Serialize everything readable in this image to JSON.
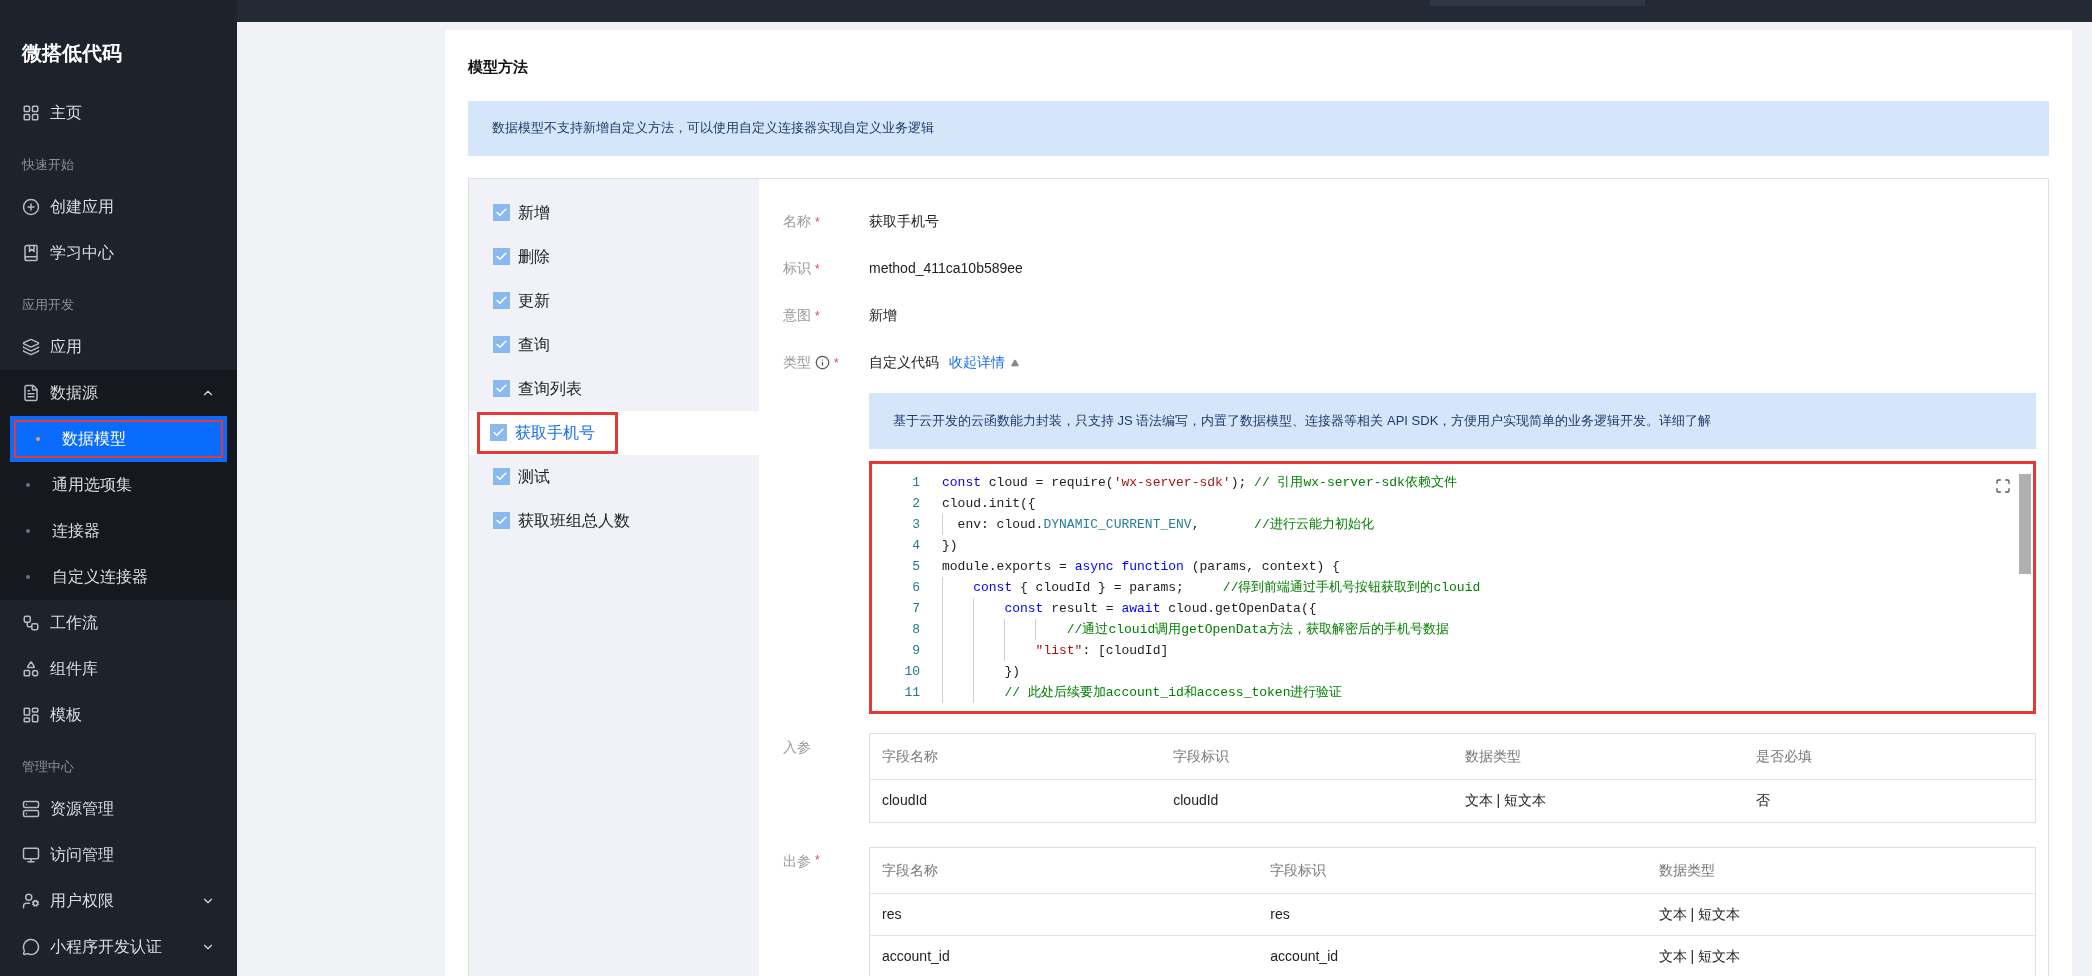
{
  "sidebar": {
    "brand": "微搭低代码",
    "groups": [
      {
        "items": [
          {
            "label": "主页"
          }
        ]
      },
      {
        "heading": "快速开始",
        "items": [
          {
            "label": "创建应用"
          },
          {
            "label": "学习中心"
          }
        ]
      },
      {
        "heading": "应用开发",
        "items": [
          {
            "label": "应用"
          },
          {
            "label": "数据源",
            "expanded": true,
            "children": [
              {
                "label": "数据模型",
                "selected": true,
                "highlighted": true
              },
              {
                "label": "通用选项集",
                "selected": false,
                "highlighted": false
              },
              {
                "label": "连接器",
                "selected": false,
                "highlighted": false
              },
              {
                "label": "自定义连接器",
                "selected": false,
                "highlighted": false
              }
            ]
          },
          {
            "label": "工作流"
          },
          {
            "label": "组件库"
          },
          {
            "label": "模板"
          }
        ]
      },
      {
        "heading": "管理中心",
        "items": [
          {
            "label": "资源管理"
          },
          {
            "label": "访问管理"
          },
          {
            "label": "用户权限",
            "expanded": false
          },
          {
            "label": "小程序开发认证",
            "expanded": false
          }
        ]
      }
    ]
  },
  "page": {
    "title": "模型方法",
    "notice": "数据模型不支持新增自定义方法，可以使用自定义连接器实现自定义业务逻辑"
  },
  "methods": [
    {
      "label": "新增",
      "checked": true,
      "selected": false,
      "highlighted": false
    },
    {
      "label": "删除",
      "checked": true,
      "selected": false,
      "highlighted": false
    },
    {
      "label": "更新",
      "checked": true,
      "selected": false,
      "highlighted": false
    },
    {
      "label": "查询",
      "checked": true,
      "selected": false,
      "highlighted": false
    },
    {
      "label": "查询列表",
      "checked": true,
      "selected": false,
      "highlighted": false
    },
    {
      "label": "获取手机号",
      "checked": true,
      "selected": true,
      "highlighted": true
    },
    {
      "label": "测试",
      "checked": true,
      "selected": false,
      "highlighted": false
    },
    {
      "label": "获取班组总人数",
      "checked": true,
      "selected": false,
      "highlighted": false
    }
  ],
  "form": {
    "fields": [
      {
        "kind": "text",
        "label": "名称",
        "required_mark": "*",
        "value": "获取手机号"
      },
      {
        "kind": "text",
        "label": "标识",
        "required_mark": "*",
        "value": "method_411ca10b589ee"
      },
      {
        "kind": "text",
        "label": "意图",
        "required_mark": "*",
        "value": "新增"
      },
      {
        "kind": "type",
        "label": "类型",
        "required_mark": "*",
        "value": "自定义代码",
        "link": "收起详情",
        "expanded": true
      }
    ],
    "description": "基于云开发的云函数能力封装，只支持 JS 语法编写，内置了数据模型、连接器等相关 API SDK，方便用户实现简单的业务逻辑开发。",
    "description_link": "详细了解",
    "code": {
      "highlighted": true,
      "lines": [
        {
          "number": "1",
          "segments": [
            {
              "kind": "keyword",
              "text": "const"
            },
            {
              "kind": "plain",
              "text": " cloud = require("
            },
            {
              "kind": "string",
              "text": "'wx-server-sdk'"
            },
            {
              "kind": "plain",
              "text": "); "
            },
            {
              "kind": "comment",
              "text": "// 引用wx-server-sdk依赖文件"
            }
          ]
        },
        {
          "number": "2",
          "segments": [
            {
              "kind": "plain",
              "text": "cloud.init({"
            }
          ]
        },
        {
          "number": "3",
          "segments": [
            {
              "kind": "plain",
              "text": "  env: cloud."
            },
            {
              "kind": "constant",
              "text": "DYNAMIC_CURRENT_ENV"
            },
            {
              "kind": "plain",
              "text": ",       "
            },
            {
              "kind": "comment",
              "text": "//进行云能力初始化"
            }
          ]
        },
        {
          "number": "4",
          "segments": [
            {
              "kind": "plain",
              "text": "})"
            }
          ]
        },
        {
          "number": "5",
          "segments": [
            {
              "kind": "plain",
              "text": "module.exports = "
            },
            {
              "kind": "keyword",
              "text": "async"
            },
            {
              "kind": "keyword",
              "text": " function"
            },
            {
              "kind": "plain",
              "text": " (params, context) {"
            }
          ]
        },
        {
          "number": "6",
          "segments": [
            {
              "kind": "keyword",
              "text": "    const"
            },
            {
              "kind": "plain",
              "text": " { cloudId } = params;     "
            },
            {
              "kind": "comment",
              "text": "//得到前端通过手机号按钮获取到的clouid"
            }
          ]
        },
        {
          "number": "7",
          "segments": [
            {
              "kind": "keyword",
              "text": "        const"
            },
            {
              "kind": "plain",
              "text": " result = "
            },
            {
              "kind": "keyword",
              "text": "await"
            },
            {
              "kind": "plain",
              "text": " cloud.getOpenData({"
            }
          ]
        },
        {
          "number": "8",
          "segments": [
            {
              "kind": "comment",
              "text": "                //通过clouid调用getOpenData方法，获取解密后的手机号数据"
            }
          ]
        },
        {
          "number": "9",
          "segments": [
            {
              "kind": "string",
              "text": "            \"list\""
            },
            {
              "kind": "plain",
              "text": ": [cloudId]"
            }
          ]
        },
        {
          "number": "10",
          "segments": [
            {
              "kind": "plain",
              "text": "        })"
            }
          ]
        },
        {
          "number": "11",
          "segments": [
            {
              "kind": "comment",
              "text": "        // 此处后续要加account_id和access_token进行验证"
            }
          ]
        }
      ]
    },
    "inputs": {
      "label": "入参",
      "columns": [
        "字段名称",
        "字段标识",
        "数据类型",
        "是否必填"
      ],
      "rows": [
        [
          "cloudId",
          "cloudId",
          "文本 | 短文本",
          "否"
        ]
      ]
    },
    "outputs": {
      "label": "出参",
      "required_mark": "*",
      "columns": [
        "字段名称",
        "字段标识",
        "数据类型"
      ],
      "rows": [
        [
          "res",
          "res",
          "文本 | 短文本"
        ],
        [
          "account_id",
          "account_id",
          "文本 | 短文本"
        ]
      ]
    }
  }
}
